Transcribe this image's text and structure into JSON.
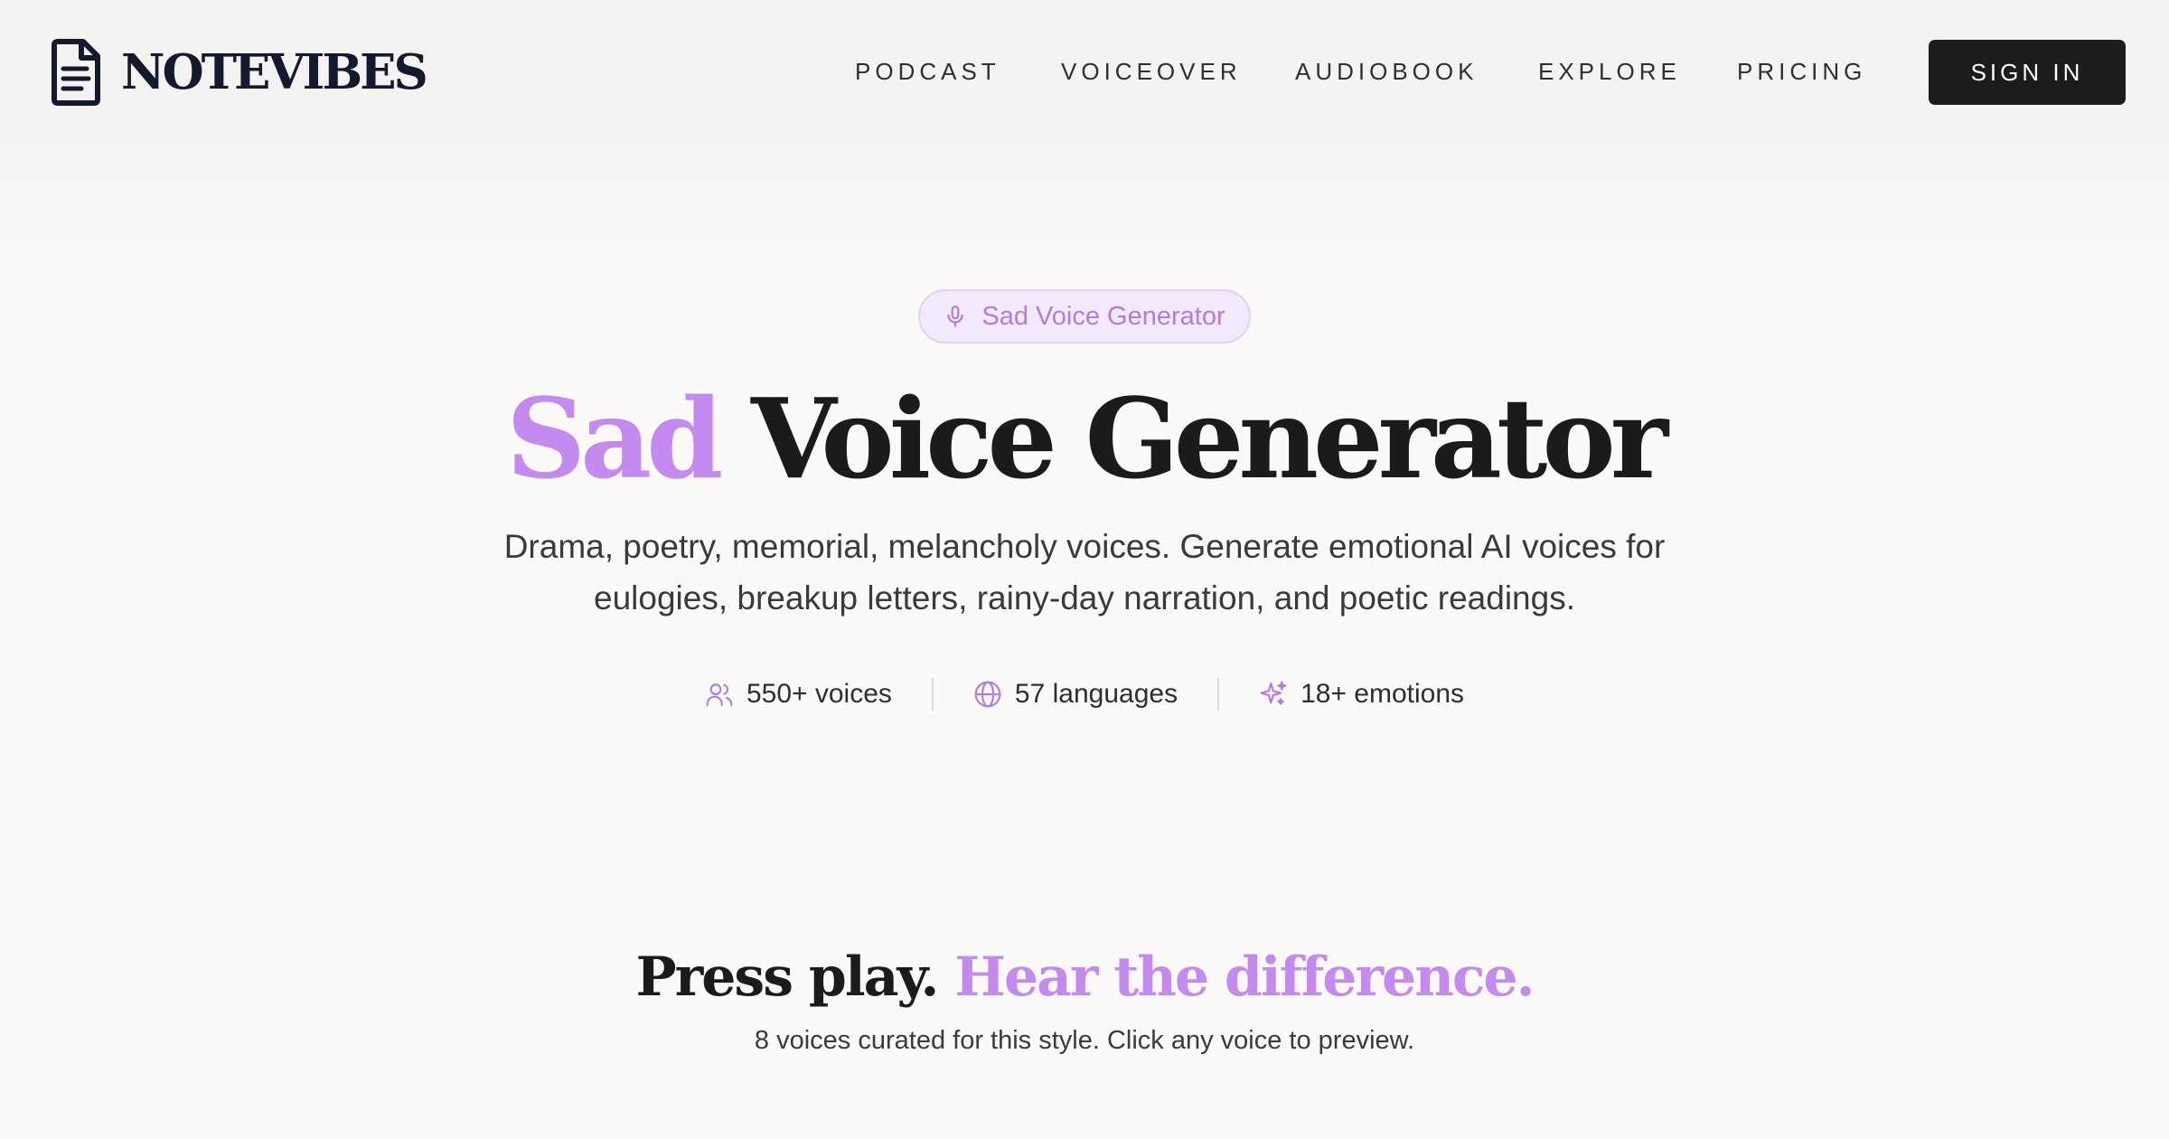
{
  "brand": {
    "name": "NOTEVIBES",
    "logo_icon": "document-icon"
  },
  "nav": {
    "items": [
      {
        "label": "PODCAST"
      },
      {
        "label": "VOICEOVER"
      },
      {
        "label": "AUDIOBOOK"
      },
      {
        "label": "EXPLORE"
      },
      {
        "label": "PRICING"
      }
    ],
    "signin_label": "SIGN IN"
  },
  "hero": {
    "badge": {
      "icon": "microphone-icon",
      "label": "Sad Voice Generator"
    },
    "title_accent": "Sad",
    "title_rest": "Voice Generator",
    "subtitle": "Drama, poetry, memorial, melancholy voices. Generate emotional AI voices for eulogies, breakup letters, rainy-day narration, and poetic readings.",
    "stats": [
      {
        "icon": "users-icon",
        "label": "550+ voices"
      },
      {
        "icon": "globe-icon",
        "label": "57 languages"
      },
      {
        "icon": "sparkles-icon",
        "label": "18+ emotions"
      }
    ]
  },
  "section": {
    "title_plain": "Press play.",
    "title_accent": "Hear the difference.",
    "subtitle": "8 voices curated for this style. Click any voice to preview."
  },
  "colors": {
    "accent": "#c58af0",
    "badge_bg": "#f3e9fc",
    "badge_text": "#b27ce0",
    "button_bg": "#1c1c1c",
    "brand_text": "#141a2e",
    "page_bg": "#fbfaf8",
    "header_bg": "#f4f3f1"
  }
}
